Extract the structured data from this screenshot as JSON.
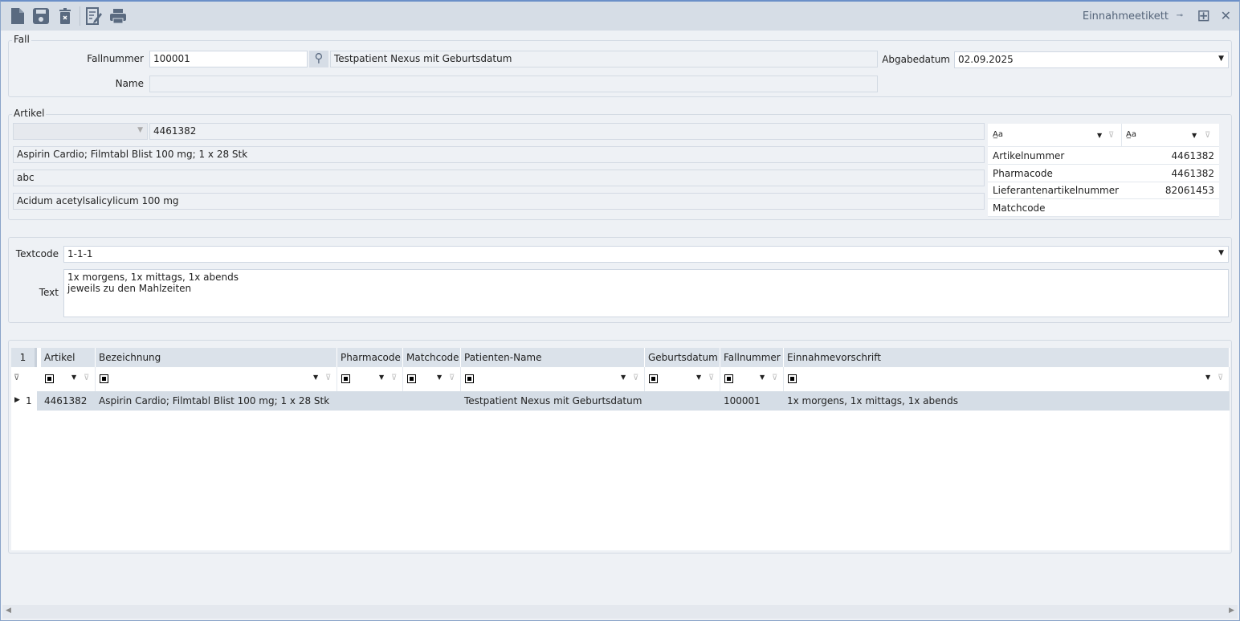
{
  "window": {
    "title": "Einnahmeetikett"
  },
  "toolbar": [
    "new-icon",
    "save-icon",
    "delete-icon",
    "edit-icon",
    "print-icon"
  ],
  "fall": {
    "group": "Fall",
    "fallnummer_label": "Fallnummer",
    "fallnummer": "100001",
    "patient": "Testpatient Nexus mit Geburtsdatum",
    "name_label": "Name",
    "name": "",
    "abgabedatum_label": "Abgabedatum",
    "abgabedatum": "02.09.2025"
  },
  "artikel": {
    "group": "Artikel",
    "nummer": "4461382",
    "bezeichnung": "Aspirin Cardio; Filmtabl Blist 100 mg; 1 x 28 Stk",
    "line2": "abc",
    "wirkstoff": "Acidum acetylsalicylicum 100 mg",
    "props": [
      {
        "k": "Artikelnummer",
        "v": "4461382"
      },
      {
        "k": "Pharmacode",
        "v": "4461382"
      },
      {
        "k": "Lieferantenartikelnummer",
        "v": "82061453"
      },
      {
        "k": "Matchcode",
        "v": ""
      }
    ],
    "filter_glyph": "A̲a"
  },
  "text": {
    "textcode_label": "Textcode",
    "textcode": "1-1-1",
    "text_label": "Text",
    "text": "1x morgens, 1x mittags, 1x abends\njeweils zu den Mahlzeiten"
  },
  "grid": {
    "count": "1",
    "columns": [
      "Artikel",
      "Bezeichnung",
      "Pharmacode",
      "Matchcode",
      "Patienten-Name",
      "Geburtsdatum",
      "Fallnummer",
      "Einnahmevorschrift"
    ],
    "rows": [
      {
        "num": "1",
        "cells": [
          "4461382",
          "Aspirin Cardio; Filmtabl Blist 100 mg; 1 x 28 Stk",
          "",
          "",
          "Testpatient Nexus mit Geburtsdatum",
          "",
          "100001",
          "1x morgens, 1x mittags, 1x abends"
        ]
      }
    ]
  }
}
